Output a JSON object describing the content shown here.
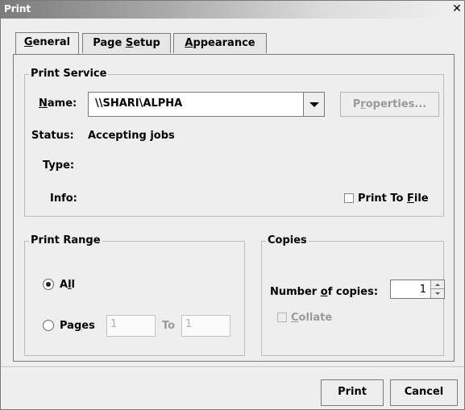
{
  "window": {
    "title": "Print",
    "close_glyph": "✕"
  },
  "tabs": [
    {
      "pre": "",
      "mnemonic": "G",
      "post": "eneral",
      "active": true
    },
    {
      "pre": "Page ",
      "mnemonic": "S",
      "post": "etup",
      "active": false
    },
    {
      "pre": "",
      "mnemonic": "A",
      "post": "ppearance",
      "active": false
    }
  ],
  "print_service": {
    "title": "Print Service",
    "name_label_mn": "N",
    "name_label_rest": "ame:",
    "name_value": "\\\\SHARI\\ALPHA",
    "properties_pre": "P",
    "properties_mn": "r",
    "properties_post": "operties...",
    "status_label": "Status:",
    "status_value": "Accepting jobs",
    "type_label": "Type:",
    "type_value": "",
    "info_label": "Info:",
    "info_value": "",
    "print_to_file_pre": "Print To ",
    "print_to_file_mn": "F",
    "print_to_file_post": "ile",
    "print_to_file_checked": false
  },
  "print_range": {
    "title": "Print Range",
    "all_pre": "A",
    "all_mn": "l",
    "all_post": "l",
    "all_checked": true,
    "pages_pre": "Pa",
    "pages_mn": "g",
    "pages_post": "es",
    "pages_checked": false,
    "from_value": "1",
    "to_label": "To",
    "to_value": "1"
  },
  "copies": {
    "title": "Copies",
    "number_pre": "Number ",
    "number_mn": "o",
    "number_post": "f copies:",
    "number_value": "1",
    "collate_mn": "C",
    "collate_post": "ollate",
    "collate_checked": false
  },
  "buttons": {
    "print": "Print",
    "cancel": "Cancel"
  }
}
